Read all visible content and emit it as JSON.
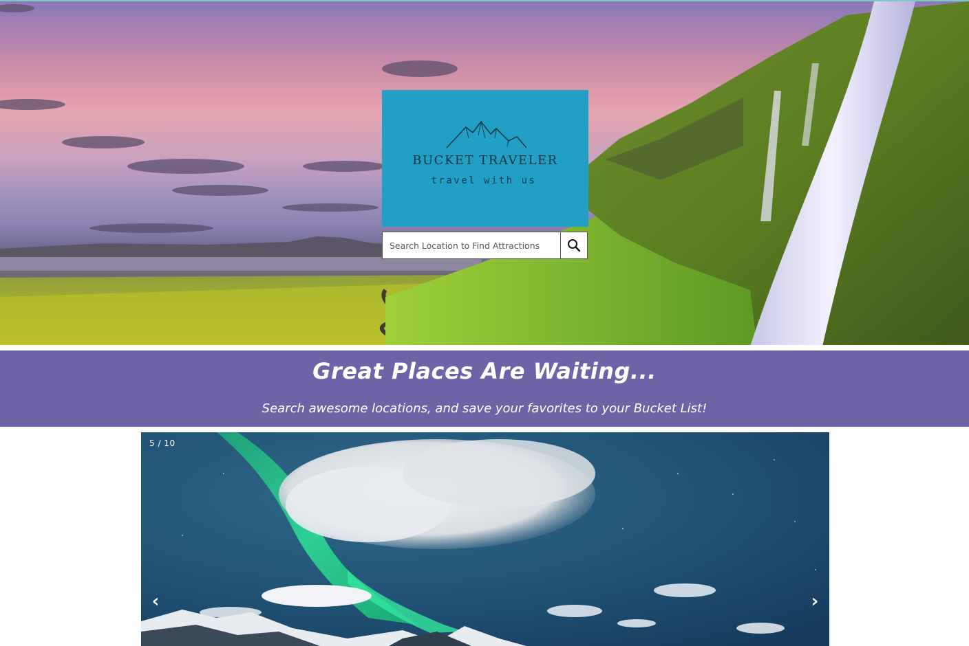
{
  "hero": {
    "image": "waterfall-landscape-image",
    "logo": {
      "title": "BUCKET TRAVELER",
      "tagline": "travel with us",
      "icon": "mountains-icon",
      "background": "#219fc4"
    },
    "search": {
      "placeholder": "Search Location to Find Attractions",
      "value": "",
      "button_icon": "search-icon"
    }
  },
  "banner": {
    "title": "Great Places Are Waiting...",
    "subtitle": "Search awesome locations, and save your favorites to your Bucket List!",
    "background": "#6f63a8"
  },
  "slideshow": {
    "counter": "5 / 10",
    "current": 5,
    "total": 10,
    "image": "aurora-borealis-image",
    "prev_label": "‹",
    "next_label": "›"
  }
}
